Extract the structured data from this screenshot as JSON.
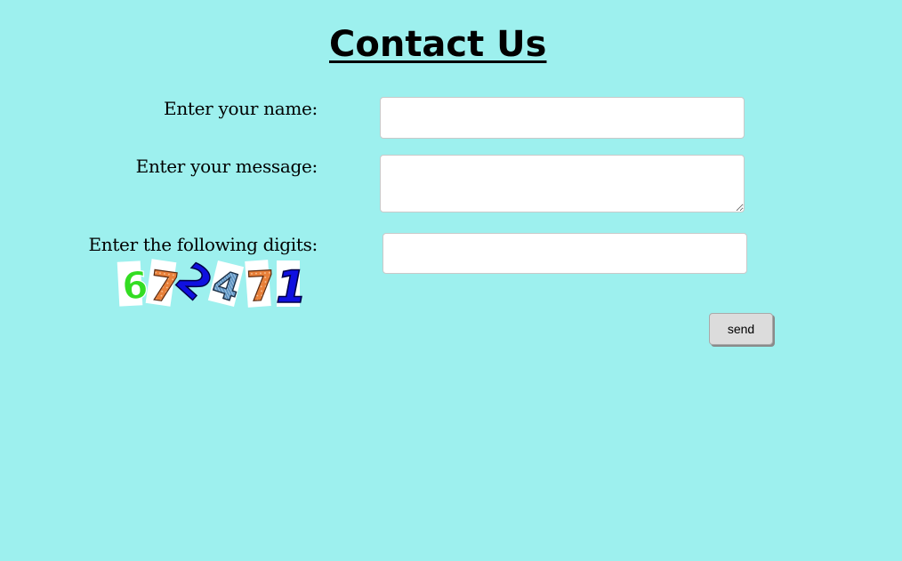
{
  "page": {
    "title": "Contact Us"
  },
  "form": {
    "name_label": "Enter your name:",
    "name_value": "",
    "message_label": "Enter your message:",
    "message_value": "",
    "digits_label": "Enter the following digits:",
    "digits_value": "",
    "captcha_digits": [
      "6",
      "7",
      "2",
      "4",
      "7",
      "1"
    ],
    "send_label": "send"
  },
  "colors": {
    "background": "#9df0ee",
    "captcha_green": "#33dd22",
    "captcha_orange": "#e8803a",
    "captcha_blue": "#1010e0",
    "captcha_steel": "#5a8fbf"
  }
}
